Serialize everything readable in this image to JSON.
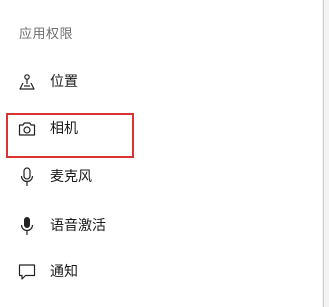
{
  "section": {
    "title": "应用权限"
  },
  "items": [
    {
      "label": "位置",
      "icon": "location-icon"
    },
    {
      "label": "相机",
      "icon": "camera-icon"
    },
    {
      "label": "麦克风",
      "icon": "microphone-icon"
    },
    {
      "label": "语音激活",
      "icon": "voice-activation-icon"
    },
    {
      "label": "通知",
      "icon": "notification-icon"
    }
  ],
  "highlight": {
    "color": "#d93333",
    "target": "相机"
  }
}
